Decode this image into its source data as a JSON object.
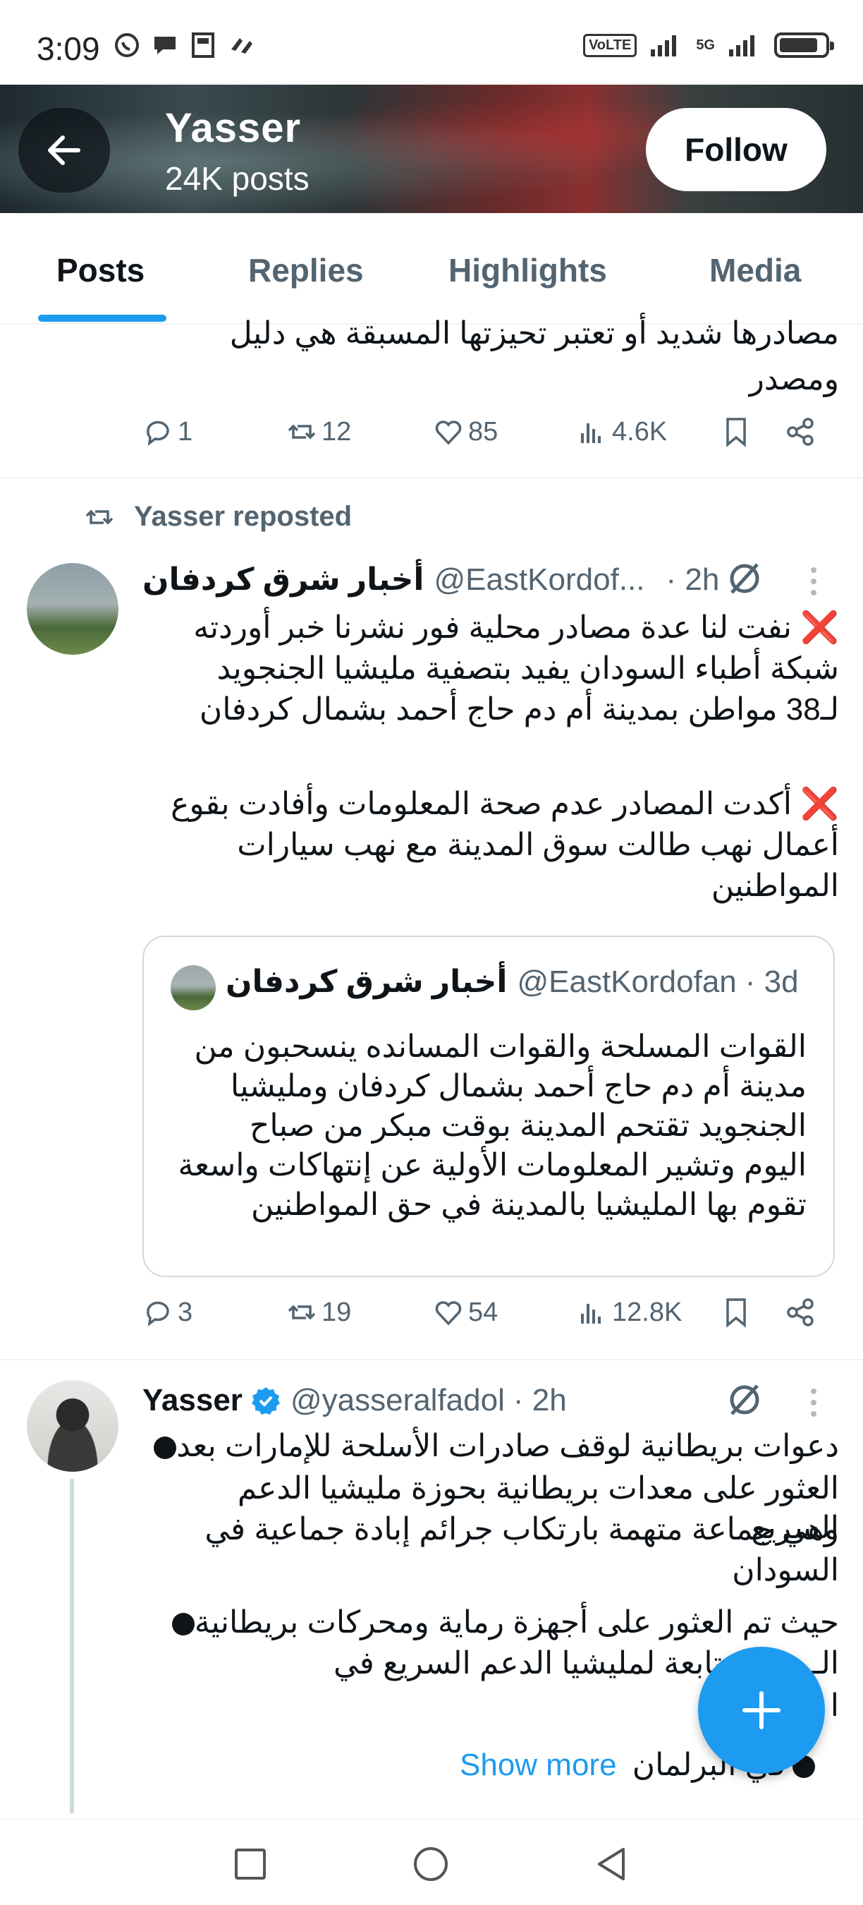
{
  "status_bar": {
    "time": "3:09",
    "network": "5G",
    "volte": "VoLTE",
    "battery_level": 0.85
  },
  "header": {
    "name": "Yasser",
    "posts_count": "24K posts",
    "follow_label": "Follow"
  },
  "tabs": [
    {
      "label": "Posts",
      "active": true
    },
    {
      "label": "Replies",
      "active": false
    },
    {
      "label": "Highlights",
      "active": false
    },
    {
      "label": "Media",
      "active": false
    }
  ],
  "tweet_partial": {
    "text_line1": "مصادرها شديد أو تعتبر تحيزتها المسبقة هي دليل",
    "text_line2": "ومصدر",
    "replies": "1",
    "reposts": "12",
    "likes": "85",
    "views": "4.6K"
  },
  "tweet_repost": {
    "repost_label": "Yasser reposted",
    "name": "أخبار شرق كردفان",
    "handle": "@EastKordof...",
    "time": "· 2h",
    "para1_line1": "❌ نفت لنا عدة مصادر محلية فور نشرنا خبر أوردته",
    "para1_line2": "شبكة أطباء السودان يفيد بتصفية مليشيا الجنجويد",
    "para1_line3": "لـ38 مواطن بمدينة أم دم حاج أحمد بشمال كردفان",
    "para2_line1": "❌ أكدت المصادر عدم صحة المعلومات وأفادت بقوع",
    "para2_line2": "أعمال نهب طالت سوق المدينة مع نهب سيارات",
    "para2_line3": "المواطنين",
    "quote": {
      "name": "أخبار شرق كردفان",
      "handle": "@EastKordofan",
      "time": "· 3d",
      "line1": "القوات المسلحة والقوات المسانده ينسحبون من",
      "line2": "مدينة أم دم حاج أحمد بشمال كردفان ومليشيا",
      "line3": "الجنجويد تقتحم المدينة بوقت مبكر من صباح",
      "line4": "اليوم وتشير المعلومات الأولية عن إنتهاكات واسعة",
      "line5": "تقوم بها المليشيا بالمدينة في حق المواطنين"
    },
    "replies": "3",
    "reposts": "19",
    "likes": "54",
    "views": "12.8K"
  },
  "tweet_yasser": {
    "name": "Yasser",
    "handle": "@yasseralfadol",
    "time": "· 2h",
    "line1": "دعوات بريطانية لوقف صادرات الأسلحة للإمارات بعد",
    "line2": "العثور على معدات بريطانية بحوزة مليشيا الدعم السريع",
    "line3": "وهي جماعة متهمة بارتكاب جرائم إبادة جماعية في",
    "line4": "السودان",
    "line5": "حيث تم العثور على أجهزة رماية ومحركات  بريطانية",
    "line6": "الـ  مواقع تابعة لمليشيا الدعم السريع في",
    "line7": "ا",
    "line8": "في البرلمان",
    "show_more": "Show more"
  },
  "colors": {
    "accent": "#1d9bf0",
    "text_primary": "#0f1419",
    "text_secondary": "#536471",
    "error_red": "#e0245e"
  },
  "icons": {
    "back": "arrow-left-icon",
    "fab": "plus-icon",
    "grok": "grok-icon",
    "more": "more-vertical-icon",
    "verified": "verified-badge-icon"
  }
}
